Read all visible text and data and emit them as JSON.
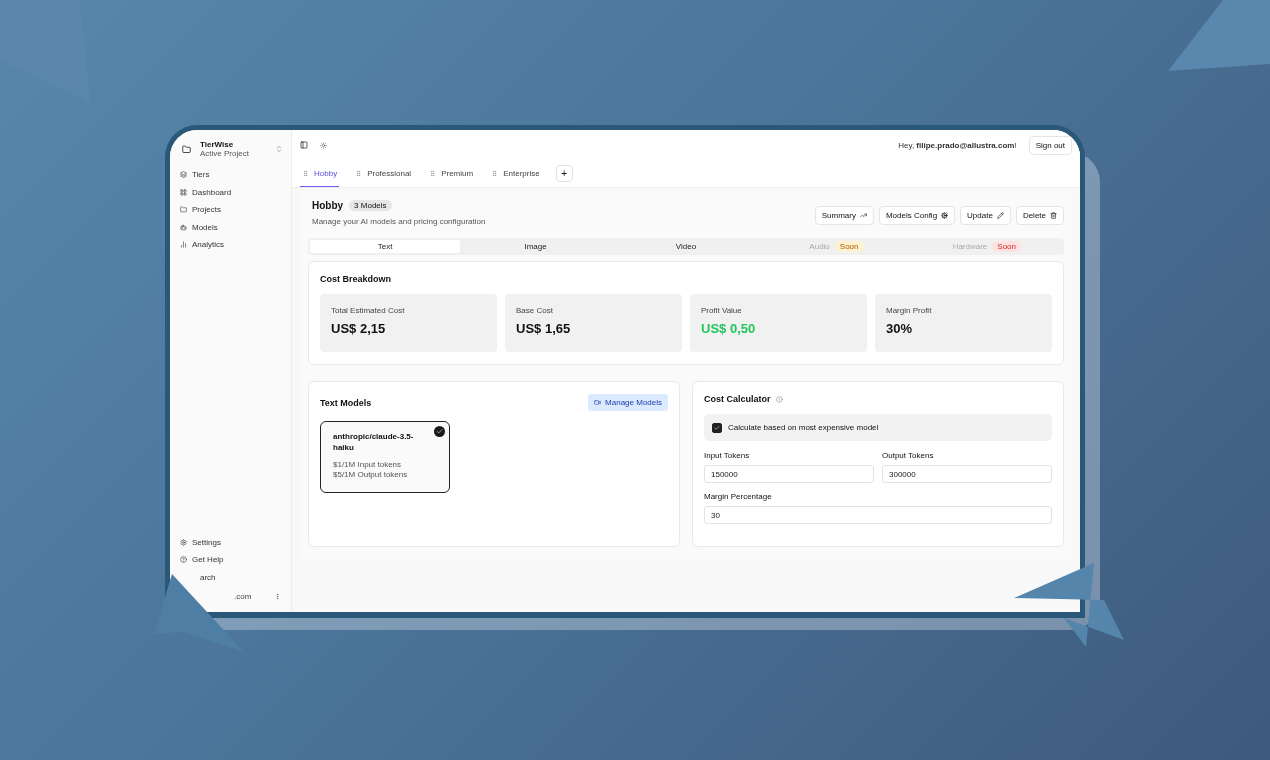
{
  "sidebar": {
    "project": {
      "name": "TierWise",
      "subtitle": "Active Project"
    },
    "nav": [
      {
        "label": "Tiers"
      },
      {
        "label": "Dashboard"
      },
      {
        "label": "Projects"
      },
      {
        "label": "Models"
      },
      {
        "label": "Analytics"
      }
    ],
    "footer": [
      {
        "label": "Settings"
      },
      {
        "label": "Get Help"
      },
      {
        "label": "arch"
      }
    ],
    "user": {
      "email": ".com"
    }
  },
  "header": {
    "greeting": "Hey, **filipe.prado@allustra.com**!",
    "sign_out": "Sign out"
  },
  "tier_tabs": [
    {
      "label": "Hobby",
      "selected": true
    },
    {
      "label": "Professional",
      "selected": false
    },
    {
      "label": "Premium",
      "selected": false
    },
    {
      "label": "Enterprise",
      "selected": false
    }
  ],
  "add_tab": "+",
  "tier": {
    "title": "Hobby",
    "badge": "3 Models",
    "description": "Manage your AI models and pricing configuration",
    "actions": [
      {
        "label": "Summary"
      },
      {
        "label": "Models Config"
      },
      {
        "label": "Update"
      },
      {
        "label": "Delete"
      }
    ]
  },
  "media_tabs": [
    {
      "label": "Text",
      "selected": true,
      "disabled": false
    },
    {
      "label": "Image",
      "selected": false,
      "disabled": false
    },
    {
      "label": "Video",
      "selected": false,
      "disabled": false
    },
    {
      "label": "Audio",
      "selected": false,
      "disabled": true,
      "badge": "Soon",
      "color": "#fdf3d0"
    },
    {
      "label": "Hardware",
      "selected": false,
      "disabled": true,
      "badge": "Soon",
      "color": "#fde2e2"
    }
  ],
  "cost_breakdown": {
    "title": "Cost Breakdown",
    "stats": [
      {
        "label": "Total Estimated Cost",
        "value": "US$ 2,15",
        "positive": false
      },
      {
        "label": "Base Cost",
        "value": "US$ 1,65",
        "positive": false
      },
      {
        "label": "Profit Value",
        "value": "US$ 0,50",
        "positive": true
      },
      {
        "label": "Margin Profit",
        "value": "30%",
        "positive": false
      }
    ]
  },
  "text_models": {
    "title": "Text Models",
    "manage_button": "Manage Models",
    "models": [
      {
        "name": "anthropic/claude-3.5-haiku",
        "input_price": "$1/1M Input tokens",
        "output_price": "$5/1M Output tokens",
        "selected": true
      }
    ]
  },
  "calculator": {
    "title": "Cost Calculator",
    "checkbox": {
      "label": "Calculate based on most expensive model",
      "checked": true
    },
    "fields": [
      {
        "label": "Input Tokens",
        "value": "150000"
      },
      {
        "label": "Output Tokens",
        "value": "300000"
      },
      {
        "label": "Margin Percentage",
        "value": "30"
      }
    ]
  }
}
